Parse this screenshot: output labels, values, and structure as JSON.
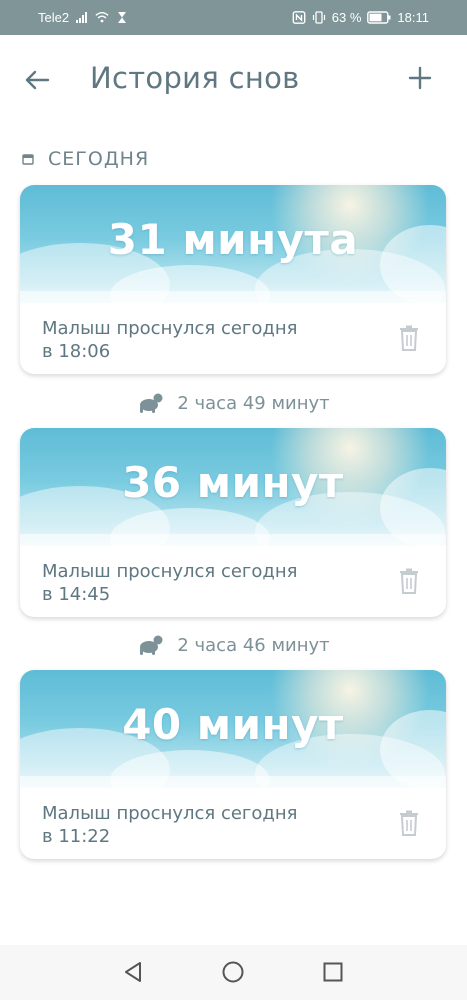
{
  "status_bar": {
    "carrier": "Tele2",
    "battery": "63 %",
    "time": "18:11",
    "icons": [
      "signal-icon",
      "wifi-icon",
      "hourglass-icon",
      "nfc-icon",
      "vibrate-icon",
      "battery-icon"
    ]
  },
  "app_bar": {
    "title": "История снов",
    "back_icon": "arrow-left-icon",
    "add_icon": "plus-icon"
  },
  "section": {
    "label": "СЕГОДНЯ",
    "icon": "calendar-icon"
  },
  "sleeps": [
    {
      "duration": "31 минута",
      "line1": "Малыш проснулся сегодня",
      "line2": "в 18:06"
    },
    {
      "duration": "36 минут",
      "line1": "Малыш проснулся сегодня",
      "line2": "в 14:45"
    },
    {
      "duration": "40 минут",
      "line1": "Малыш проснулся сегодня",
      "line2": "в 11:22"
    }
  ],
  "awake_gaps": [
    {
      "text": "2 часа 49 минут",
      "icon": "crawling-baby-icon"
    },
    {
      "text": "2 часа 46 минут",
      "icon": "crawling-baby-icon"
    }
  ],
  "colors": {
    "text": "#5f7781",
    "sky_top": "#5fbcd6",
    "sky_bottom": "#dff3f8",
    "status_bar": "#7f9598"
  },
  "nav_bar": {
    "icons": [
      "back-triangle-icon",
      "home-circle-icon",
      "recents-square-icon"
    ]
  }
}
